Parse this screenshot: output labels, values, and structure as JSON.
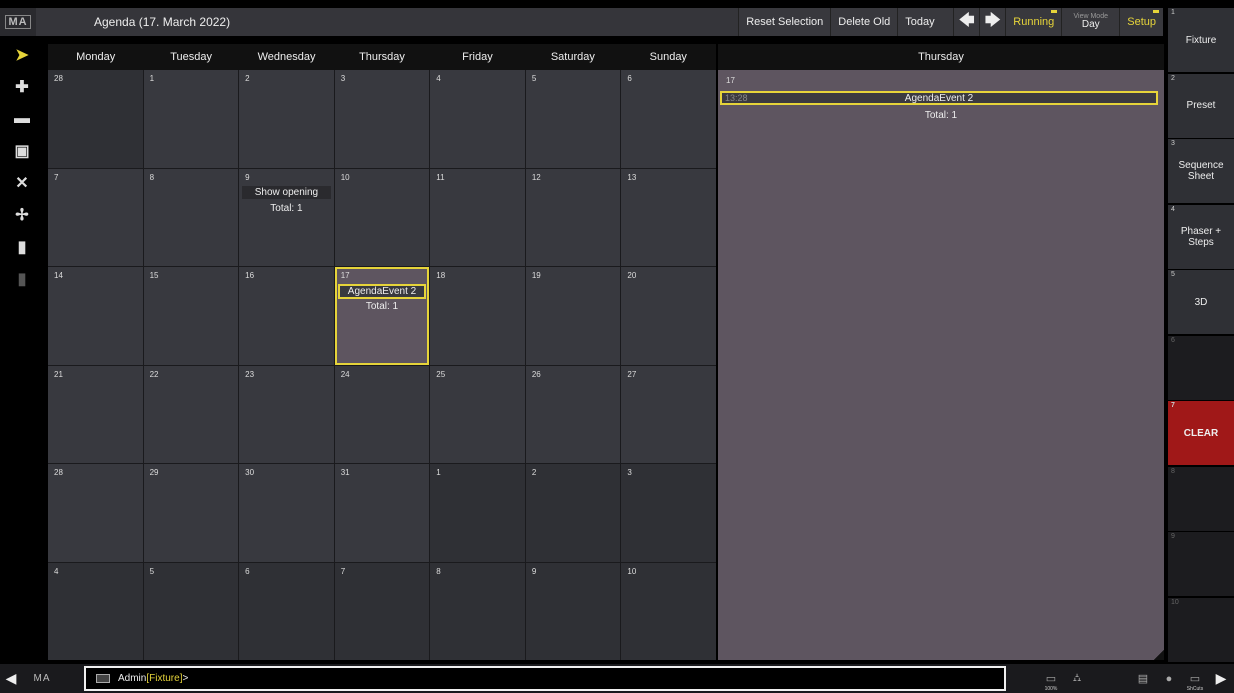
{
  "app": {
    "logo": "MA",
    "title": "Agenda (17. March 2022)"
  },
  "toolbar": {
    "reset_selection": "Reset Selection",
    "delete_old": "Delete Old",
    "today": "Today",
    "prev_icon": "arrow-left-icon",
    "next_icon": "arrow-right-icon",
    "running": "Running",
    "view_mode_label": "View Mode",
    "view_mode_value": "Day",
    "setup": "Setup"
  },
  "left_tools": [
    {
      "name": "pointer-icon",
      "glyph": "➤",
      "active": true
    },
    {
      "name": "plus-icon",
      "glyph": "✚"
    },
    {
      "name": "minus-icon",
      "glyph": "▬"
    },
    {
      "name": "edit-icon",
      "glyph": "▣"
    },
    {
      "name": "tools-icon",
      "glyph": "✕"
    },
    {
      "name": "insert-icon",
      "glyph": "✢"
    },
    {
      "name": "enter-icon",
      "glyph": "▮"
    },
    {
      "name": "exit-icon",
      "glyph": "▮",
      "dim": true
    }
  ],
  "calendar": {
    "weekdays": [
      "Monday",
      "Tuesday",
      "Wednesday",
      "Thursday",
      "Friday",
      "Saturday",
      "Sunday"
    ],
    "weeks": [
      [
        {
          "day": "28",
          "other": true
        },
        {
          "day": "1"
        },
        {
          "day": "2"
        },
        {
          "day": "3"
        },
        {
          "day": "4"
        },
        {
          "day": "5"
        },
        {
          "day": "6"
        }
      ],
      [
        {
          "day": "7"
        },
        {
          "day": "8"
        },
        {
          "day": "9",
          "event": "Show opening",
          "total": "Total: 1"
        },
        {
          "day": "10"
        },
        {
          "day": "11"
        },
        {
          "day": "12"
        },
        {
          "day": "13"
        }
      ],
      [
        {
          "day": "14"
        },
        {
          "day": "15"
        },
        {
          "day": "16"
        },
        {
          "day": "17",
          "today": true,
          "event": "AgendaEvent 2",
          "selected": true,
          "total": "Total: 1"
        },
        {
          "day": "18"
        },
        {
          "day": "19"
        },
        {
          "day": "20"
        }
      ],
      [
        {
          "day": "21"
        },
        {
          "day": "22"
        },
        {
          "day": "23"
        },
        {
          "day": "24"
        },
        {
          "day": "25"
        },
        {
          "day": "26"
        },
        {
          "day": "27"
        }
      ],
      [
        {
          "day": "28"
        },
        {
          "day": "29"
        },
        {
          "day": "30"
        },
        {
          "day": "31"
        },
        {
          "day": "1",
          "other": true
        },
        {
          "day": "2",
          "other": true
        },
        {
          "day": "3",
          "other": true
        }
      ],
      [
        {
          "day": "4",
          "other": true
        },
        {
          "day": "5",
          "other": true
        },
        {
          "day": "6",
          "other": true
        },
        {
          "day": "7",
          "other": true
        },
        {
          "day": "8",
          "other": true
        },
        {
          "day": "9",
          "other": true
        },
        {
          "day": "10",
          "other": true
        }
      ]
    ]
  },
  "day_panel": {
    "header": "Thursday",
    "day": "17",
    "event_time": "13:28",
    "event_name": "AgendaEvent 2",
    "total": "Total: 1"
  },
  "views": [
    {
      "num": "1",
      "label": "Fixture"
    },
    {
      "num": "2",
      "label": "Preset"
    },
    {
      "num": "3",
      "label": "Sequence Sheet"
    },
    {
      "num": "4",
      "label": "Phaser + Steps"
    },
    {
      "num": "5",
      "label": "3D"
    },
    {
      "num": "6",
      "label": "",
      "empty": true
    },
    {
      "num": "7",
      "label": "CLEAR",
      "clear": true
    },
    {
      "num": "8",
      "label": "",
      "empty": true
    },
    {
      "num": "9",
      "label": "",
      "empty": true
    },
    {
      "num": "10",
      "label": "",
      "empty": true
    }
  ],
  "command_line": {
    "user": "Admin",
    "destination": "[Fixture]",
    "suffix": ">"
  },
  "bottom": {
    "logo": "MA",
    "zoom_label": "100%",
    "shortcuts_label": "ShCuts"
  },
  "colors": {
    "accent": "#e6d43a",
    "clear": "#a01818",
    "today_bg": "#5e5560"
  }
}
